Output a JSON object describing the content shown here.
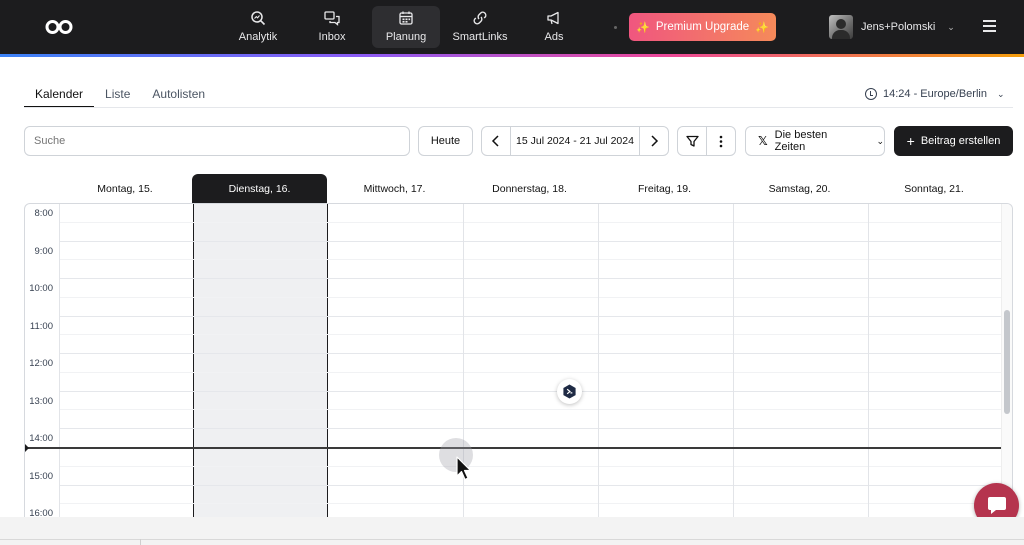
{
  "nav": {
    "items": [
      {
        "label": "Analytik",
        "icon": "analytics-search-icon"
      },
      {
        "label": "Inbox",
        "icon": "inbox-chat-icon"
      },
      {
        "label": "Planung",
        "icon": "calendar-icon",
        "active": true
      },
      {
        "label": "SmartLinks",
        "icon": "link-icon"
      },
      {
        "label": "Ads",
        "icon": "megaphone-icon"
      }
    ],
    "premium_label": "Premium Upgrade",
    "premium_colors": [
      "#f0567f",
      "#f58a5a"
    ],
    "user_name": "Jens+Polomski"
  },
  "tabs": [
    {
      "label": "Kalender",
      "active": true
    },
    {
      "label": "Liste"
    },
    {
      "label": "Autolisten"
    }
  ],
  "timezone": "14:24 - Europe/Berlin",
  "toolbar": {
    "search_placeholder": "Suche",
    "today_label": "Heute",
    "date_range": "15 Jul 2024 - 21 Jul 2024",
    "best_times_label": "Die besten Zeiten",
    "create_label": "Beitrag erstellen"
  },
  "calendar": {
    "days": [
      {
        "label": "Montag, 15."
      },
      {
        "label": "Dienstag, 16.",
        "today": true
      },
      {
        "label": "Mittwoch, 17."
      },
      {
        "label": "Donnerstag, 18."
      },
      {
        "label": "Freitag, 19."
      },
      {
        "label": "Samstag, 20."
      },
      {
        "label": "Sonntag, 21."
      }
    ],
    "hours": [
      "8:00",
      "9:00",
      "10:00",
      "11:00",
      "12:00",
      "13:00",
      "14:00",
      "15:00",
      "16:00"
    ],
    "current_time": "14:24"
  },
  "colors": {
    "dark": "#1c1c1e",
    "chat_button": "#b5344e"
  }
}
